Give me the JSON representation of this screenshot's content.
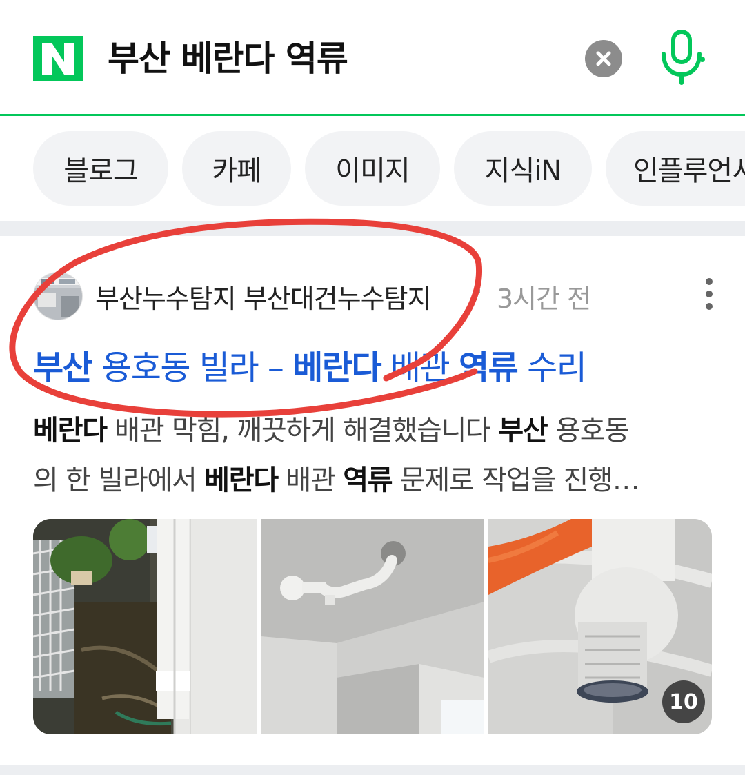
{
  "search": {
    "logo_letter": "N",
    "query": "부산 베란다 역류",
    "clear_icon": "close-icon",
    "mic_icon": "microphone-icon",
    "accent_color": "#03c75a"
  },
  "chips": [
    {
      "label": "블로그"
    },
    {
      "label": "카페"
    },
    {
      "label": "이미지"
    },
    {
      "label": "지식iN"
    },
    {
      "label": "인플루언서"
    }
  ],
  "result": {
    "source_name": "부산누수탐지 부산대건누수탐지",
    "separator": "·",
    "time_ago": "3시간 전",
    "title_parts": [
      "부산",
      " 용호동 빌라 – ",
      "베란다",
      " 배관 ",
      "역류",
      " 수리"
    ],
    "snippet_line1": [
      "베란다",
      " 배관 막힘, 깨끗하게 해결했습니다 ",
      "부산",
      " 용호동"
    ],
    "snippet_line2": [
      "의 한 빌라에서 ",
      "베란다",
      " 배관 ",
      "역류",
      " 문제로 작업을 진행…"
    ],
    "image_count": "10",
    "link_color": "#1a5bd6"
  }
}
